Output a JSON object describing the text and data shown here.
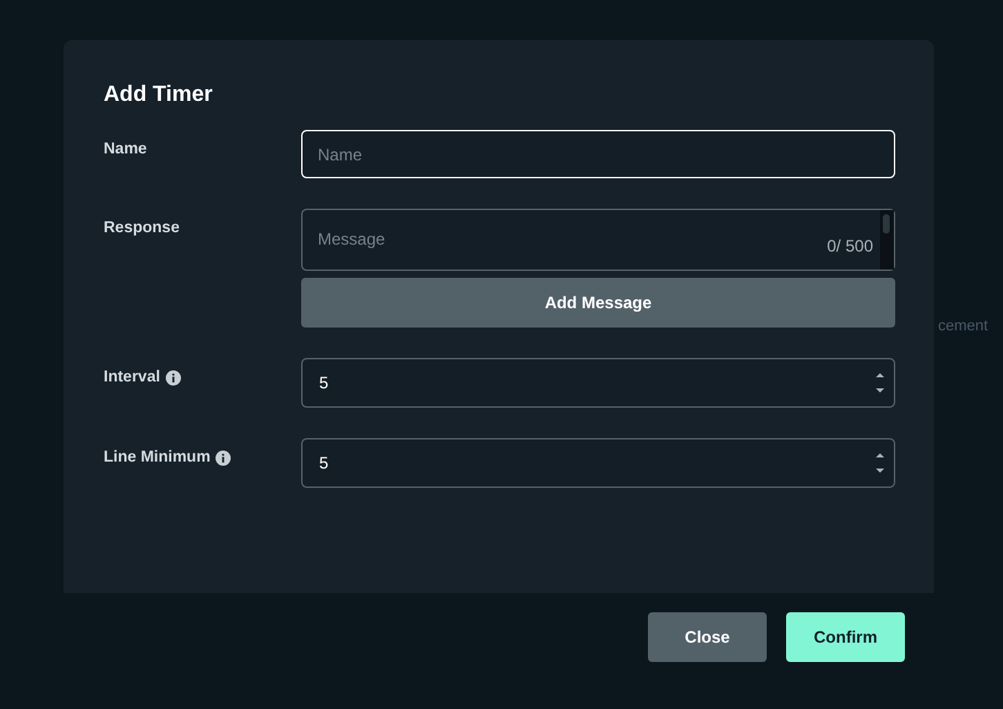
{
  "background": {
    "text": "cement"
  },
  "dialog": {
    "title": "Add Timer",
    "fields": [
      {
        "kind": "text",
        "label": "Name",
        "placeholder": "Name",
        "focused": true
      },
      {
        "kind": "message",
        "label": "Response",
        "placeholder": "Message",
        "counter": "0/ 500",
        "button": "Add Message"
      },
      {
        "kind": "number",
        "label": "Interval",
        "info": true,
        "value": "5"
      },
      {
        "kind": "number",
        "label": "Line Minimum",
        "info": true,
        "value": "5"
      }
    ],
    "buttons": [
      {
        "label": "Close",
        "kind": "secondary"
      },
      {
        "label": "Confirm",
        "kind": "primary"
      }
    ]
  }
}
